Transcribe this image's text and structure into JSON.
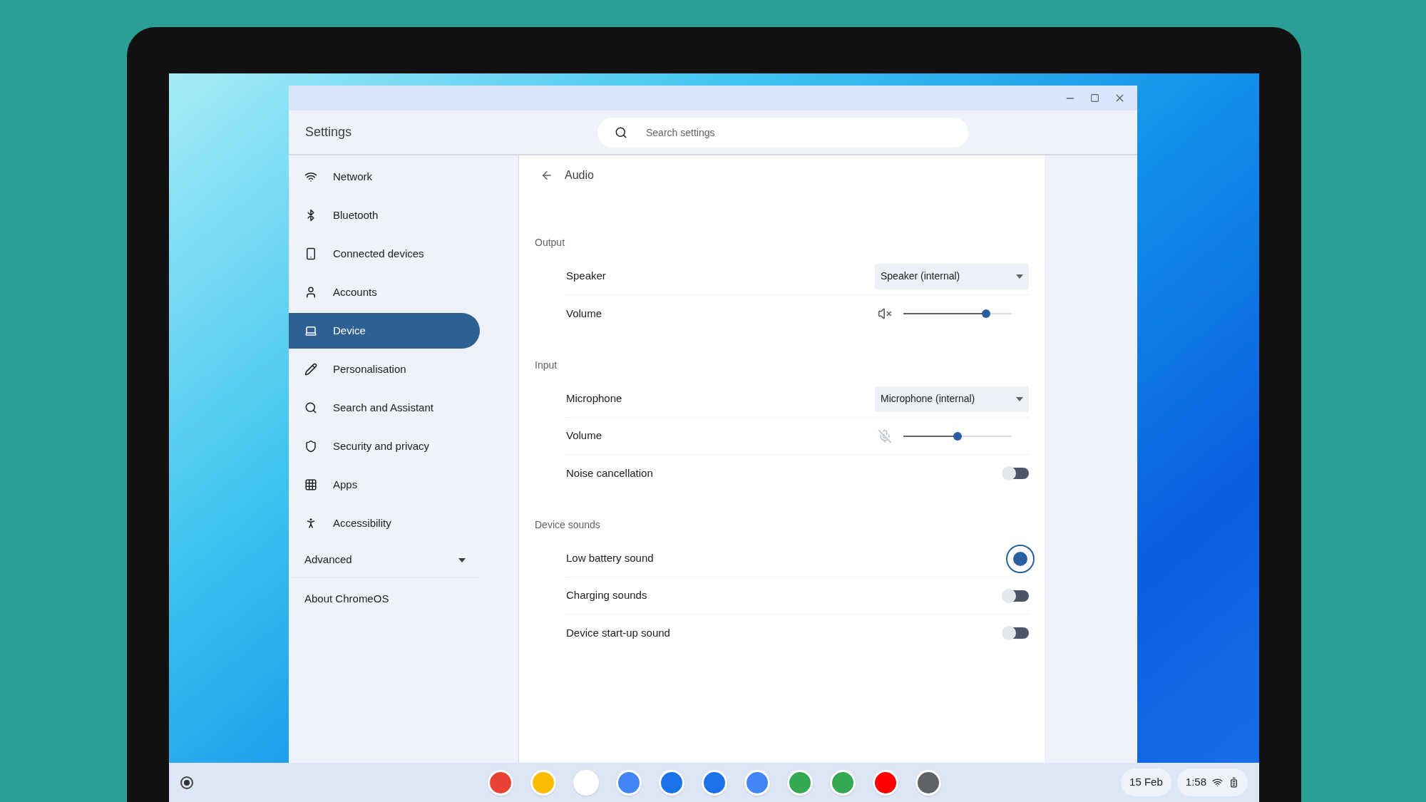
{
  "window": {
    "title": "Settings"
  },
  "search": {
    "placeholder": "Search settings"
  },
  "sidebar": {
    "items": [
      {
        "label": "Network",
        "selected": false
      },
      {
        "label": "Bluetooth",
        "selected": false
      },
      {
        "label": "Connected devices",
        "selected": false
      },
      {
        "label": "Accounts",
        "selected": false
      },
      {
        "label": "Device",
        "selected": true
      },
      {
        "label": "Personalisation",
        "selected": false
      },
      {
        "label": "Search and Assistant",
        "selected": false
      },
      {
        "label": "Security and privacy",
        "selected": false
      },
      {
        "label": "Apps",
        "selected": false
      },
      {
        "label": "Accessibility",
        "selected": false
      }
    ],
    "advanced": {
      "label": "Advanced",
      "expanded": false
    },
    "about": "About ChromeOS"
  },
  "page": {
    "title": "Audio",
    "sections": [
      {
        "title": "Output",
        "rows": [
          {
            "kind": "dropdown",
            "label": "Speaker",
            "value": "Speaker (internal)"
          },
          {
            "kind": "slider",
            "label": "Volume",
            "level": 0.76
          }
        ]
      },
      {
        "title": "Input",
        "rows": [
          {
            "kind": "dropdown",
            "label": "Microphone",
            "value": "Microphone (internal)"
          },
          {
            "kind": "slider",
            "label": "Volume",
            "level": 0.5
          },
          {
            "kind": "toggle",
            "label": "Noise cancellation",
            "on": false
          }
        ]
      },
      {
        "title": "Device sounds",
        "rows": [
          {
            "kind": "toggle",
            "label": "Low battery sound",
            "on": true
          },
          {
            "kind": "toggle",
            "label": "Charging sounds",
            "on": false
          },
          {
            "kind": "toggle",
            "label": "Device start-up sound",
            "on": false
          }
        ]
      }
    ]
  },
  "shelf": {
    "date": "15 Feb",
    "time": "1:58"
  }
}
